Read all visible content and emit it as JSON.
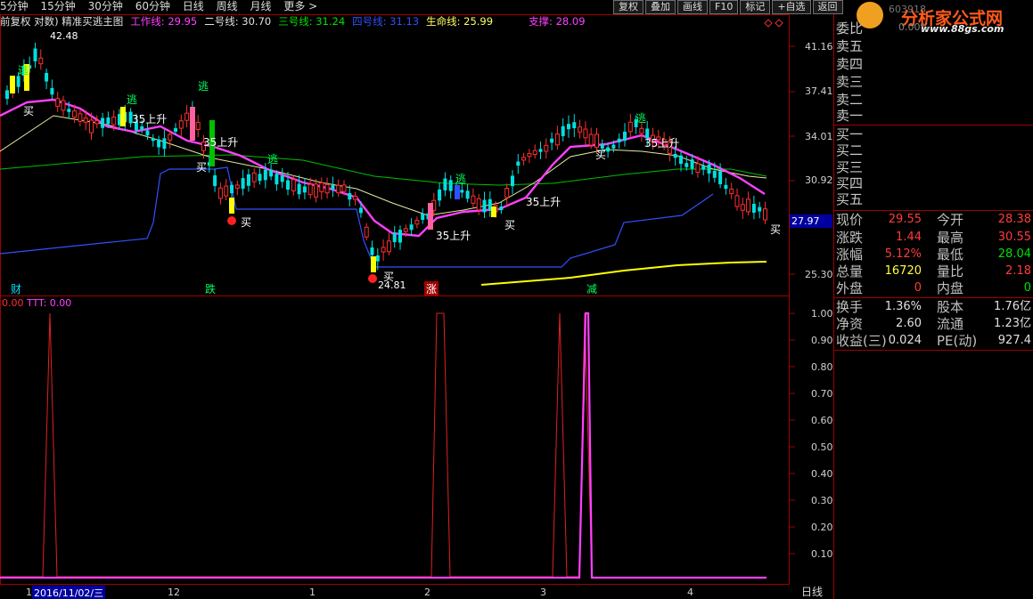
{
  "toolbar": {
    "periods": [
      "5分钟",
      "15分钟",
      "30分钟",
      "60分钟",
      "日线",
      "周线",
      "月线",
      "更多 >"
    ],
    "buttons": [
      "复权",
      "叠加",
      "画线",
      "F10",
      "标记",
      "+自选",
      "返回"
    ]
  },
  "indicator_line": {
    "prefix": "前复权 对数) 精准买逃主图",
    "work": "工作线: 29.95",
    "line2": "二号线: 30.70",
    "line3": "三号线: 31.24",
    "line4": "四号线: 31.13",
    "life": "生命线: 25.99",
    "support": "支撑: 28.09"
  },
  "colors": {
    "red": "#ff3c3c",
    "cyan": "#00ffff",
    "magenta": "#ff40ff",
    "yellow": "#ffff00",
    "green": "#00c000",
    "blue": "#3050ff",
    "grid": "#8b0000"
  },
  "price_axis": [
    "41.16",
    "37.41",
    "34.01",
    "30.92",
    "27.97",
    "25.30"
  ],
  "current_price_tag": "27.97",
  "sub_axis": [
    "1.00",
    "0.90",
    "0.80",
    "0.70",
    "0.60",
    "0.50",
    "0.40",
    "0.30",
    "0.20",
    "0.10"
  ],
  "annotations": {
    "high": "42.48",
    "low": "24.81",
    "buy": "买",
    "escape": "逃",
    "up35": "35上升",
    "cai": "财",
    "die": "跌",
    "zhang": "涨",
    "jian": "减"
  },
  "sub_header": {
    "left": "0.00",
    "ttt": "TTT: 0.00"
  },
  "date_axis": {
    "first": "1",
    "date": "2016/11/02/三",
    "m12": "12",
    "m1": "1",
    "m2": "2",
    "m3": "3",
    "m4": "4"
  },
  "bottom_tab": "日线",
  "logo": {
    "text": "分析家公式网",
    "url": "www.88gs.com",
    "code": "603918"
  },
  "quote": {
    "order_book": [
      "委比",
      "卖五",
      "卖四",
      "卖三",
      "卖二",
      "卖一",
      "买一",
      "买二",
      "买三",
      "买四",
      "买五"
    ],
    "weibi_value": "0.00%",
    "rows": [
      {
        "l1": "现价",
        "v1": "29.55",
        "l2": "今开",
        "v2": "28.38"
      },
      {
        "l1": "涨跌",
        "v1": "1.44",
        "l2": "最高",
        "v2": "30.55"
      },
      {
        "l1": "涨幅",
        "v1": "5.12%",
        "l2": "最低",
        "v2": "28.04"
      },
      {
        "l1": "总量",
        "v1": "16720",
        "l2": "量比",
        "v2": "2.18"
      },
      {
        "l1": "外盘",
        "v1": "0",
        "l2": "内盘",
        "v2": "0"
      },
      {
        "l1": "换手",
        "v1": "1.36%",
        "l2": "股本",
        "v2": "1.76亿"
      },
      {
        "l1": "净资",
        "v1": "2.60",
        "l2": "流通",
        "v2": "1.23亿"
      },
      {
        "l1": "收益(三)",
        "v1": "0.024",
        "l2": "PE(动)",
        "v2": "927.4"
      }
    ]
  }
}
